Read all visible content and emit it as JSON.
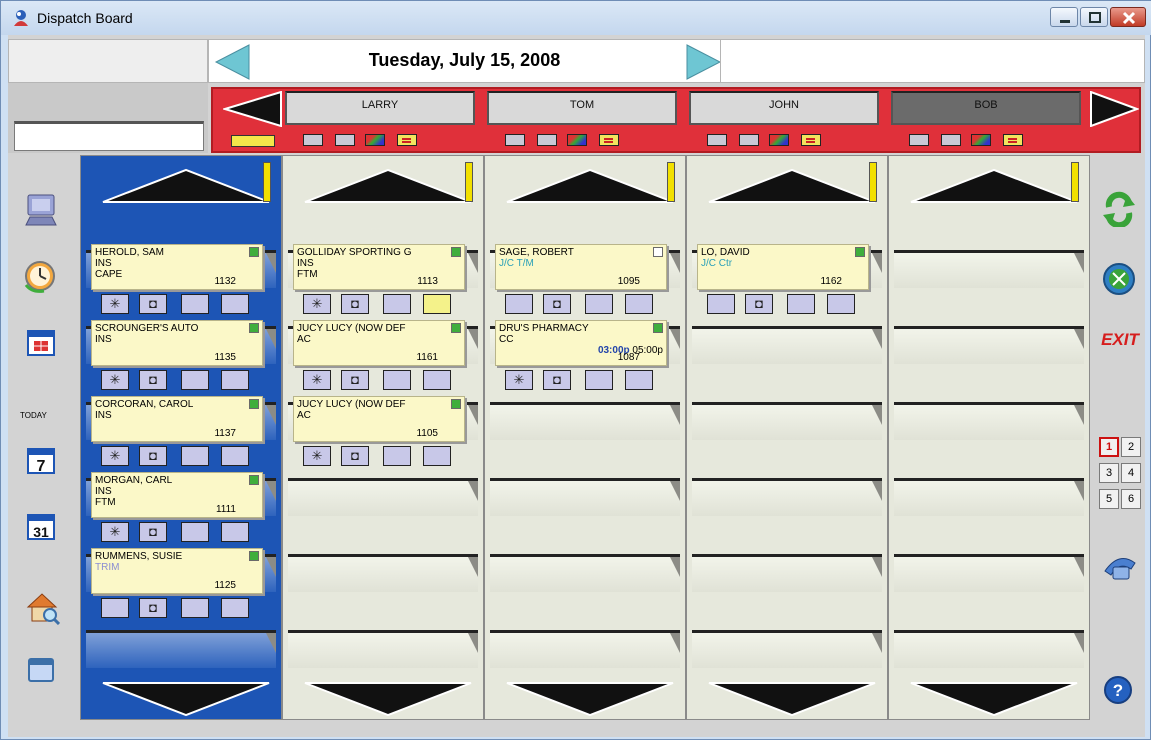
{
  "window": {
    "title": "Dispatch Board"
  },
  "date": "Tuesday, July 15, 2008",
  "technicians": [
    {
      "name": "LARRY"
    },
    {
      "name": "TOM"
    },
    {
      "name": "JOHN"
    },
    {
      "name": "BOB"
    }
  ],
  "toolbar": {
    "today_label": "TODAY",
    "calendar_week": "7",
    "calendar_month": "31",
    "exit_label": "EXIT"
  },
  "pages": [
    "1",
    "2",
    "3",
    "4",
    "5",
    "6"
  ],
  "columns": [
    {
      "cards": [
        {
          "name": "HEROLD, SAM",
          "type": "INS",
          "loc": "CAPE",
          "num": "1132"
        },
        {
          "name": "SCROUNGER'S AUTO",
          "type": "INS",
          "loc": "",
          "num": "1135"
        },
        {
          "name": "CORCORAN, CAROL",
          "type": "INS",
          "loc": "",
          "num": "1137"
        },
        {
          "name": "MORGAN, CARL",
          "type": "INS",
          "loc": "FTM",
          "num": "1111"
        },
        {
          "name": "RUMMENS, SUSIE",
          "type": "TRIM",
          "loc": "",
          "num": "1125"
        }
      ]
    },
    {
      "cards": [
        {
          "name": "GOLLIDAY SPORTING G",
          "type": "INS",
          "loc": "FTM",
          "num": "1113"
        },
        {
          "name": "JUCY LUCY (NOW DEF",
          "type": "AC",
          "loc": "",
          "num": "1161"
        },
        {
          "name": "JUCY LUCY (NOW DEF",
          "type": "AC",
          "loc": "",
          "num": "1105"
        }
      ]
    },
    {
      "cards": [
        {
          "name": "SAGE, ROBERT",
          "type": "J/C T/M",
          "loc": "",
          "num": "1095"
        },
        {
          "name": "DRU'S PHARMACY",
          "type": "CC",
          "loc": "",
          "num": "1087",
          "time_start": "03:00p",
          "time_end": "05:00p"
        }
      ]
    },
    {
      "cards": [
        {
          "name": "LO, DAVID",
          "type": "J/C Ctr",
          "loc": "",
          "num": "1162"
        }
      ]
    },
    {
      "cards": []
    }
  ],
  "icon_names": [
    "computer-icon",
    "clock-icon",
    "today-calendar-icon",
    "week-calendar-icon",
    "month-calendar-icon",
    "house-search-icon",
    "window-icon",
    "refresh-icon",
    "compass-icon",
    "exit-icon",
    "phone-icon",
    "help-icon"
  ],
  "colors": {
    "tech_bar": "#e0303a",
    "first_column": "#1d55b5",
    "card": "#fbf8c8",
    "flag": "#3fae3c"
  }
}
